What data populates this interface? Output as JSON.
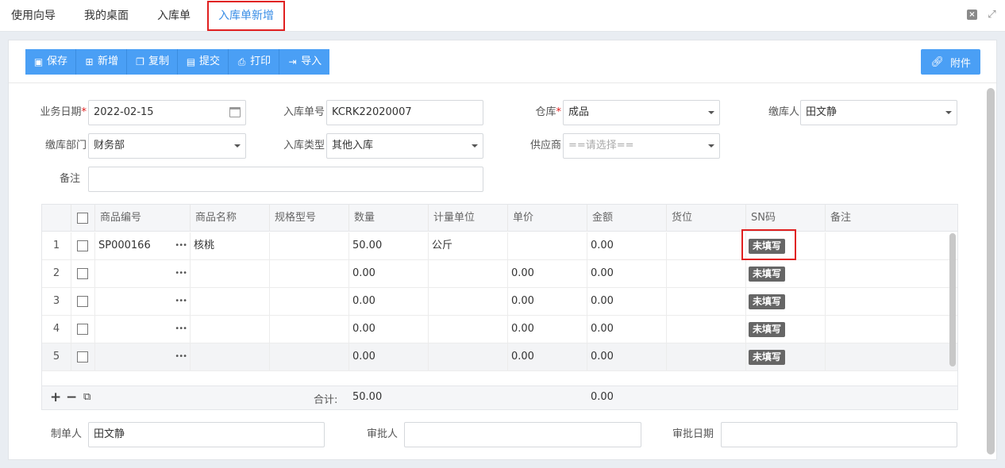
{
  "tabs": [
    {
      "label": "使用向导"
    },
    {
      "label": "我的桌面"
    },
    {
      "label": "入库单"
    },
    {
      "label": "入库单新增"
    }
  ],
  "toolbar": {
    "save": "保存",
    "add": "新增",
    "copy": "复制",
    "submit": "提交",
    "print": "打印",
    "import": "导入",
    "attachment": "附件"
  },
  "form": {
    "biz_date_label": "业务日期",
    "biz_date": "2022-02-15",
    "order_no_label": "入库单号",
    "order_no": "KCRK22020007",
    "warehouse_label": "仓库",
    "warehouse": "成品",
    "payer_label": "缴库人",
    "payer": "田文静",
    "dept_label": "缴库部门",
    "dept": "财务部",
    "type_label": "入库类型",
    "type": "其他入库",
    "supplier_label": "供应商",
    "supplier_placeholder": "==请选择==",
    "remark_label": "备注",
    "remark": ""
  },
  "grid": {
    "columns": [
      "商品编号",
      "商品名称",
      "规格型号",
      "数量",
      "计量单位",
      "单价",
      "金额",
      "货位",
      "SN码",
      "备注"
    ],
    "rows": [
      {
        "no": "1",
        "code": "SP000166",
        "name": "核桃",
        "spec": "",
        "qty": "50.00",
        "unit": "公斤",
        "price": "",
        "amount": "0.00",
        "loc": "",
        "sn": "未填写",
        "remark": ""
      },
      {
        "no": "2",
        "code": "",
        "name": "",
        "spec": "",
        "qty": "0.00",
        "unit": "",
        "price": "0.00",
        "amount": "0.00",
        "loc": "",
        "sn": "未填写",
        "remark": ""
      },
      {
        "no": "3",
        "code": "",
        "name": "",
        "spec": "",
        "qty": "0.00",
        "unit": "",
        "price": "0.00",
        "amount": "0.00",
        "loc": "",
        "sn": "未填写",
        "remark": ""
      },
      {
        "no": "4",
        "code": "",
        "name": "",
        "spec": "",
        "qty": "0.00",
        "unit": "",
        "price": "0.00",
        "amount": "0.00",
        "loc": "",
        "sn": "未填写",
        "remark": ""
      },
      {
        "no": "5",
        "code": "",
        "name": "",
        "spec": "",
        "qty": "0.00",
        "unit": "",
        "price": "0.00",
        "amount": "0.00",
        "loc": "",
        "sn": "未填写",
        "remark": ""
      }
    ],
    "footer": {
      "total_label": "合计:",
      "total_qty": "50.00",
      "total_amount": "0.00"
    }
  },
  "bottom": {
    "maker_label": "制单人",
    "maker": "田文静",
    "approver_label": "审批人",
    "approver": "",
    "approve_date_label": "审批日期",
    "approve_date": ""
  },
  "colors": {
    "accent": "#4a9ff5",
    "active_tab_text": "#3a8ee6",
    "highlight": "#e02020",
    "sn_badge": "#666666"
  }
}
